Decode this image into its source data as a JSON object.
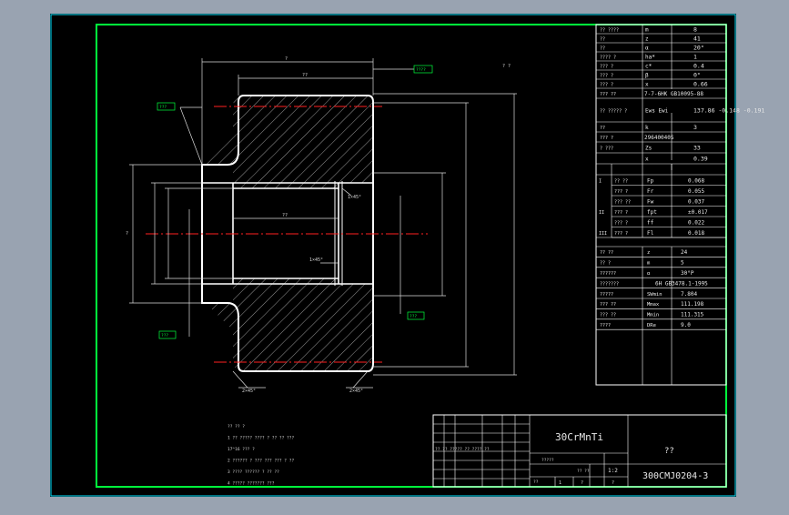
{
  "colors": {
    "outer_bg": "#99a3b1",
    "sheet_bg": "#000000",
    "frame_cyan": "#00e5ff",
    "frame_green": "#00ff3c",
    "white": "#ffffff",
    "red": "#ff2020",
    "label": "#d8d8d8"
  },
  "title_block": {
    "material": "30CrMnTi",
    "part_name": "??",
    "drawing_number": "300CMJ0204-3",
    "scale": "1:2",
    "sheet_cells": [
      "?? ?? ????? ?? ???? ??",
      "?????",
      "??",
      "?? ??",
      "1",
      "?",
      "?"
    ]
  },
  "params_upper": [
    {
      "name": "?? ????",
      "symbol": "m",
      "value": "8"
    },
    {
      "name": "??",
      "symbol": "z",
      "value": "41"
    },
    {
      "name": "??",
      "symbol": "α",
      "value": "20°"
    },
    {
      "name": "???? ?",
      "symbol": "ha*",
      "value": "1"
    },
    {
      "name": "??? ?",
      "symbol": "c*",
      "value": "0.4"
    },
    {
      "name": "??? ?",
      "symbol": "β",
      "value": "0°"
    },
    {
      "name": "??? ?",
      "symbol": "x",
      "value": "0.66"
    },
    {
      "name": "??? ??",
      "symbol": "",
      "value": "7-7-6HK GB10095-88"
    },
    {
      "name": "?? ????? ?",
      "symbol": "Ews Ewi",
      "value": "137.86 -0.148 -0.191"
    },
    {
      "name": "??",
      "symbol": "k",
      "value": "3"
    },
    {
      "name": "??? ?",
      "symbol": "afta",
      "value": "29640040S"
    },
    {
      "name": "? ???",
      "symbol": "Zs",
      "value": "33"
    },
    {
      "name": "",
      "symbol": "x",
      "value": "0.39"
    }
  ],
  "params_lower": [
    {
      "group": "I",
      "name": "?? ??",
      "symbol": "Fp",
      "value": "0.068"
    },
    {
      "group": "I",
      "name": "??? ?",
      "symbol": "Fr",
      "value": "0.055"
    },
    {
      "group": "I",
      "name": "??? ??",
      "symbol": "Fw",
      "value": "0.037"
    },
    {
      "group": "II",
      "name": "??? ?",
      "symbol": "fpt",
      "value": "±0.017"
    },
    {
      "group": "II",
      "name": "??? ?",
      "symbol": "ff",
      "value": "0.022"
    },
    {
      "group": "III",
      "name": "??? ?",
      "symbol": "Fl",
      "value": "0.018"
    }
  ],
  "params_mating": [
    {
      "name": "?? ??",
      "symbol": "z",
      "value": "24"
    },
    {
      "name": "?? ?",
      "symbol": "m",
      "value": "5"
    },
    {
      "name": "??????",
      "symbol": "α",
      "value": "30°P"
    },
    {
      "name": "???????",
      "symbol": "",
      "value": "6H GB3478.1-1995"
    },
    {
      "name": "?????",
      "symbol": "SWmin",
      "value": "7.804"
    },
    {
      "name": "??? ??",
      "symbol": "Mmax",
      "value": "111.198"
    },
    {
      "name": "??? ??",
      "symbol": "Mmin",
      "value": "111.315"
    },
    {
      "name": "????",
      "symbol": "DRe",
      "value": "9.0"
    }
  ],
  "notes": [
    "?? ?? ?",
    "1 ?? ????? ???? ? ?? ?? ???",
    "17^16 ??? ?",
    "2 ?????? ? ??? ??? ??? ? ??",
    "3 ???? ?????? ? ?? ??",
    "4 ????? ??????? ???"
  ],
  "annotations": {
    "chamfer_left": "2×45°",
    "chamfer_right": "2×45°",
    "small_chamfer": "1×45°",
    "inner_chamfer": "1×45°",
    "dim_top_a": "?",
    "dim_top_b": "??",
    "dim_mid": "??",
    "dim_side": "?",
    "note_box_1": "???",
    "note_box_2": "????",
    "note_box_3": "???",
    "note_box_4": "???",
    "corner_mark": "? ?"
  }
}
